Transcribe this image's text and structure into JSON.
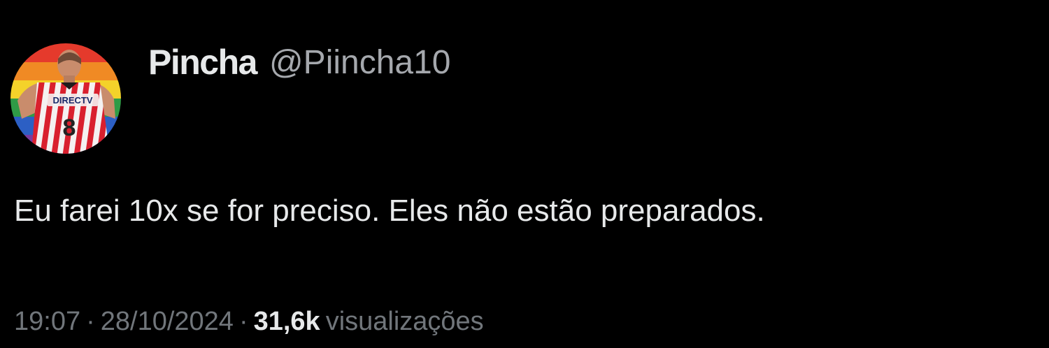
{
  "author": {
    "display_name": "Pincha",
    "handle": "@Piincha10",
    "avatar": {
      "icon": "profile-avatar-rainbow-jersey",
      "jersey_text": "DIRECTV",
      "jersey_number": "8"
    }
  },
  "tweet": {
    "text": "Eu farei 10x se for preciso. Eles não estão preparados."
  },
  "meta": {
    "time": "19:07",
    "date": "28/10/2024",
    "separator": "·",
    "views_count": "31,6k",
    "views_label": "visualizações"
  },
  "colors": {
    "background": "#000000",
    "primary_text": "#e7e9ea",
    "secondary_text": "#71767b"
  }
}
